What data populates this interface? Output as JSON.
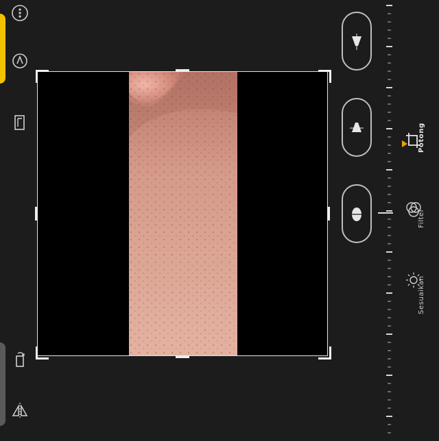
{
  "tabs": [
    {
      "id": "potong",
      "label": "Potong",
      "active": true
    },
    {
      "id": "filter",
      "label": "Filter",
      "active": false
    },
    {
      "id": "sesuaikan",
      "label": "Sesuaikan",
      "active": false
    }
  ],
  "icons": {
    "more": "more-vertical-icon",
    "compass": "compass-icon",
    "frame": "frame-icon",
    "rotate": "rotate-icon",
    "flip": "flip-icon",
    "crop": "crop-rotate-icon",
    "filter": "filter-circles-icon",
    "adjust": "adjust-sun-icon"
  },
  "colors": {
    "accent": "#f2c200",
    "active_tab_marker": "#f2a000",
    "background": "#1c1c1c"
  }
}
